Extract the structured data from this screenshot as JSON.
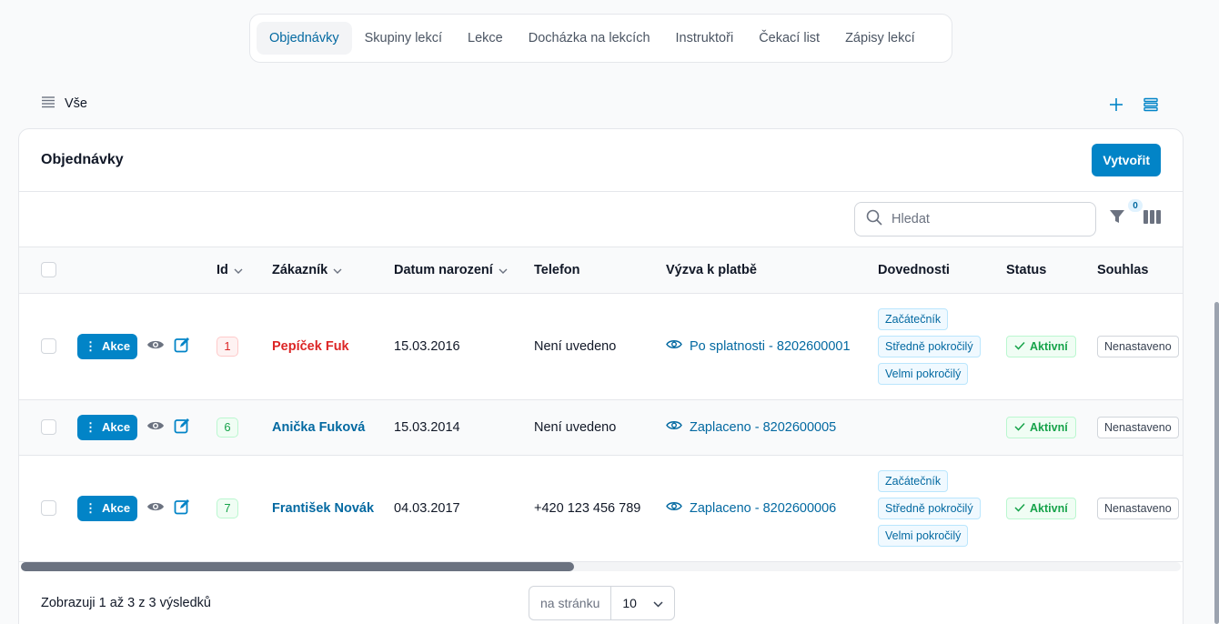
{
  "tabs": [
    {
      "label": "Objednávky",
      "active": true
    },
    {
      "label": "Skupiny lekcí",
      "active": false
    },
    {
      "label": "Lekce",
      "active": false
    },
    {
      "label": "Docházka na lekcích",
      "active": false
    },
    {
      "label": "Instruktoři",
      "active": false
    },
    {
      "label": "Čekací list",
      "active": false
    },
    {
      "label": "Zápisy lekcí",
      "active": false
    }
  ],
  "view": {
    "label": "Vše"
  },
  "card": {
    "title": "Objednávky",
    "create_label": "Vytvořit"
  },
  "search": {
    "placeholder": "Hledat",
    "value": ""
  },
  "filter": {
    "count": "0"
  },
  "columns": {
    "id": "Id",
    "customer": "Zákazník",
    "birth": "Datum narození",
    "phone": "Telefon",
    "payment": "Výzva k platbě",
    "skills": "Dovednosti",
    "status": "Status",
    "consent": "Souhlas"
  },
  "action_label": "Akce",
  "rows": [
    {
      "id": "1",
      "customer": "Pepíček Fuk",
      "birth": "15.03.2016",
      "phone": "Není uvedeno",
      "payment": "Po splatnosti - 8202600001",
      "skills": [
        "Začátečník",
        "Středně pokročilý",
        "Velmi pokročilý"
      ],
      "status": "Aktivní",
      "consent": "Nenastaveno"
    },
    {
      "id": "6",
      "customer": "Anička Fuková",
      "birth": "15.03.2014",
      "phone": "Není uvedeno",
      "payment": "Zaplaceno - 8202600005",
      "skills": [],
      "status": "Aktivní",
      "consent": "Nenastaveno"
    },
    {
      "id": "7",
      "customer": "František Novák",
      "birth": "04.03.2017",
      "phone": "+420 123 456 789",
      "payment": "Zaplaceno - 8202600006",
      "skills": [
        "Začátečník",
        "Středně pokročilý",
        "Velmi pokročilý"
      ],
      "status": "Aktivní",
      "consent": "Nenastaveno"
    }
  ],
  "footer": {
    "summary": "Zobrazuji 1 až 3 z 3 výsledků",
    "per_page_label": "na stránku",
    "per_page_value": "10"
  },
  "colors": {
    "primary": "#0284c7",
    "link": "#0369a1",
    "danger": "#dc2626",
    "success": "#16a34a"
  }
}
